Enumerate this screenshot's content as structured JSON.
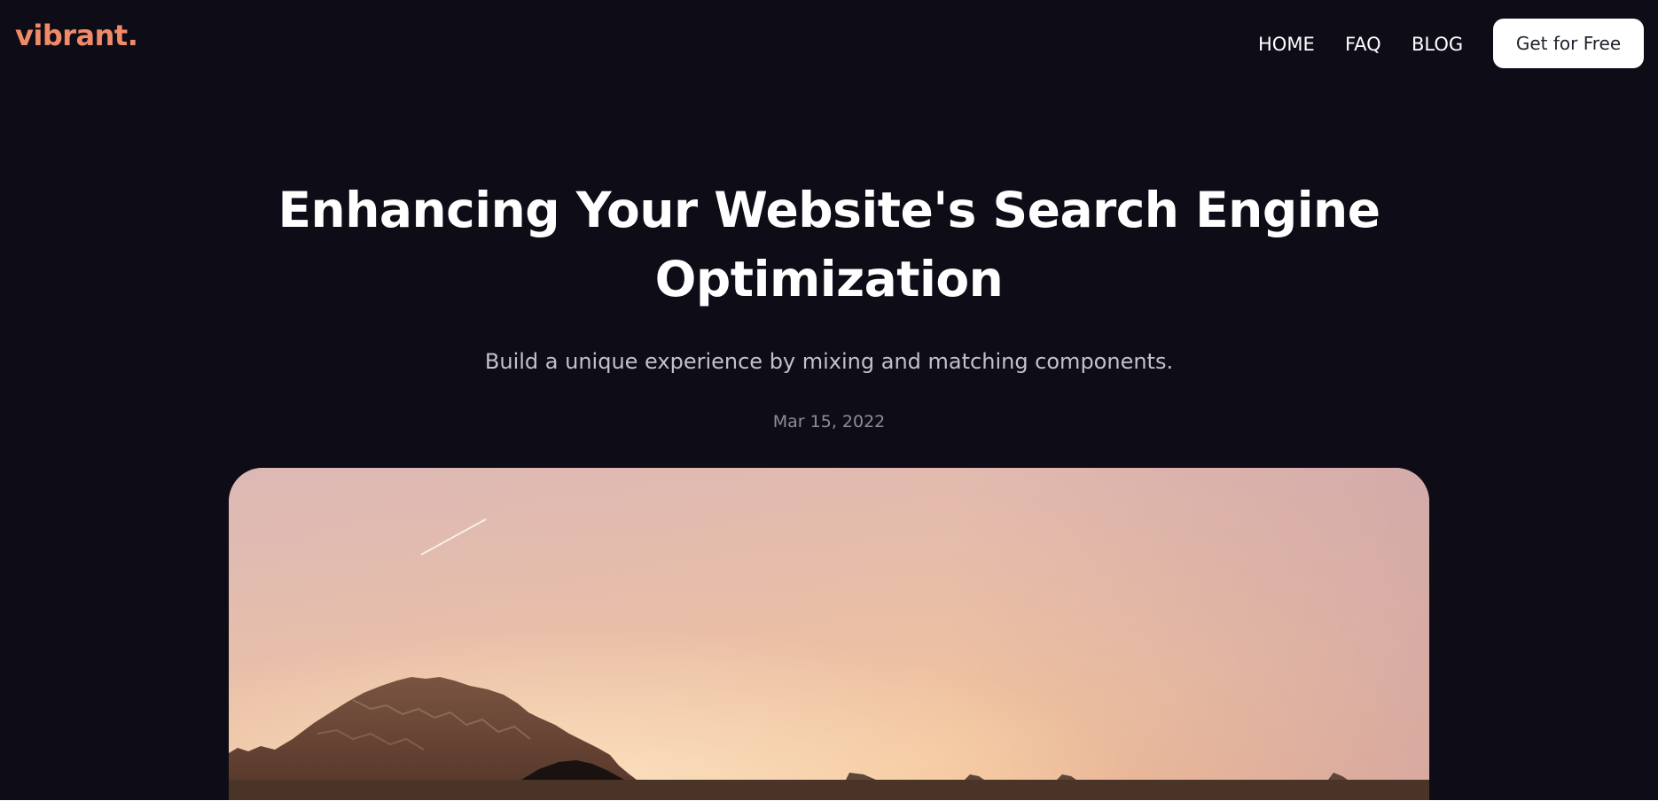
{
  "brand": {
    "logo": "vibrant.",
    "accent_color": "#f08a68",
    "background_color": "#0e0d17"
  },
  "nav": {
    "items": [
      {
        "label": "HOME"
      },
      {
        "label": "FAQ"
      },
      {
        "label": "BLOG"
      }
    ],
    "cta_label": "Get for Free"
  },
  "hero": {
    "title": "Enhancing Your Website's Search Engine Optimization",
    "subtitle": "Build a unique experience by mixing and matching components.",
    "date": "Mar 15, 2022"
  }
}
